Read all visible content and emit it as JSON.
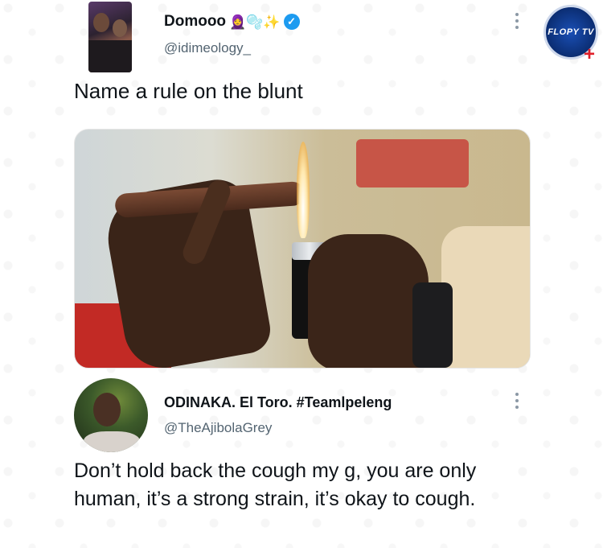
{
  "watermark": {
    "brand": "FLOPY TV"
  },
  "tweet1": {
    "display_name": "Domooo",
    "emojis": "🧕🫧✨",
    "handle": "@idimeology_",
    "text": "Name a rule on the blunt",
    "verified": true
  },
  "tweet2": {
    "display_name": "ODINAKA. El Toro. #Teamlpeleng",
    "handle": "@TheAjibolaGrey",
    "text": "Don’t hold back the cough my g, you are only human, it’s a strong strain, it’s okay to cough."
  },
  "colors": {
    "verified": "#1d9bf0",
    "handle": "#536471",
    "logo_blue": "#0b2d72",
    "logo_cross": "#e0202a"
  }
}
